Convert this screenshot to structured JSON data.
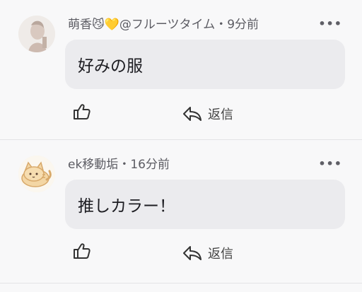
{
  "comments": [
    {
      "author": "萌香😼💛@フルーツタイム",
      "separator": "・",
      "time": "9分前",
      "text": "好みの服",
      "more_icon": "•••",
      "reply_label": "返信",
      "avatar_icon": "user-photo-avatar"
    },
    {
      "author": "ek移動垢",
      "separator": "・",
      "time": "16分前",
      "text": "推しカラー！",
      "more_icon": "•••",
      "reply_label": "返信",
      "avatar_icon": "cat-avatar"
    }
  ],
  "colors": {
    "background": "#f8f8f9",
    "bubble": "#ebebee",
    "meta_text": "#5c5c63"
  }
}
